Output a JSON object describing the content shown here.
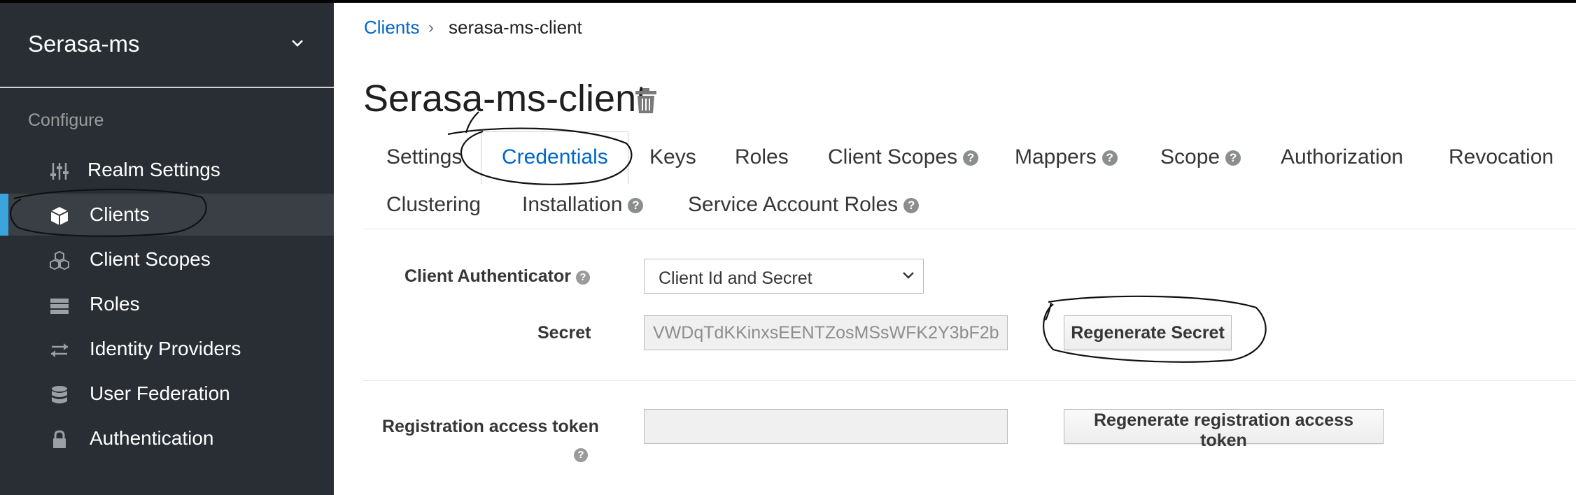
{
  "sidebar": {
    "realm_name": "Serasa-ms",
    "section_label": "Configure",
    "items": [
      {
        "label": "Realm Settings",
        "icon": "sliders-icon"
      },
      {
        "label": "Clients",
        "icon": "cube-icon"
      },
      {
        "label": "Client Scopes",
        "icon": "cubes-icon"
      },
      {
        "label": "Roles",
        "icon": "roles-icon"
      },
      {
        "label": "Identity Providers",
        "icon": "exchange-icon"
      },
      {
        "label": "User Federation",
        "icon": "database-icon"
      },
      {
        "label": "Authentication",
        "icon": "lock-icon"
      }
    ],
    "active_item": "Clients"
  },
  "breadcrumb": {
    "parent": "Clients",
    "separator": "›",
    "current": "serasa-ms-client"
  },
  "page": {
    "title": "Serasa-ms-client"
  },
  "tabs": {
    "row1": [
      {
        "label": "Settings"
      },
      {
        "label": "Credentials",
        "active": true
      },
      {
        "label": "Keys"
      },
      {
        "label": "Roles"
      },
      {
        "label": "Client Scopes",
        "help": true
      },
      {
        "label": "Mappers",
        "help": true
      },
      {
        "label": "Scope",
        "help": true
      },
      {
        "label": "Authorization"
      },
      {
        "label": "Revocation"
      }
    ],
    "row2": [
      {
        "label": "Clustering"
      },
      {
        "label": "Installation",
        "help": true
      },
      {
        "label": "Service Account Roles",
        "help": true
      }
    ],
    "help_glyph": "?"
  },
  "form": {
    "client_authenticator": {
      "label": "Client Authenticator",
      "selected": "Client Id and Secret"
    },
    "secret": {
      "label": "Secret",
      "value": "VWDqTdKKinxsEENTZosMSsWFK2Y3bF2b",
      "button": "Regenerate Secret"
    },
    "registration_token": {
      "label": "Registration access token",
      "value": "",
      "button": "Regenerate registration access token"
    }
  },
  "colors": {
    "sidebar_bg": "#292e34",
    "active_item_bg": "#393f44",
    "accent": "#39a5dc",
    "link": "#0066cc"
  }
}
